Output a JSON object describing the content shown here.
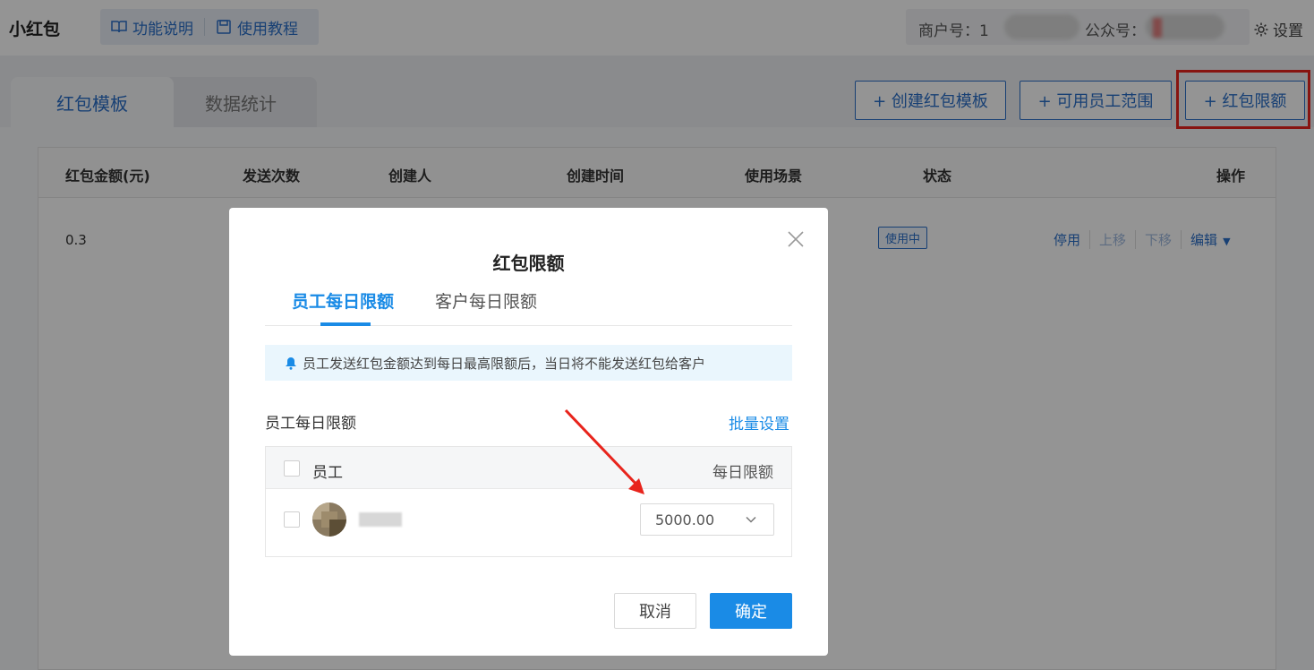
{
  "app": {
    "title": "小红包"
  },
  "top_links": [
    {
      "label": "功能说明",
      "icon": "book-icon"
    },
    {
      "label": "使用教程",
      "icon": "save-icon"
    }
  ],
  "merchant": {
    "merchant_label": "商户号：1",
    "account_label": "公众号："
  },
  "settings": {
    "label": "设置",
    "icon": "gear-icon"
  },
  "main_tabs": [
    {
      "label": "红包模板",
      "active": true
    },
    {
      "label": "数据统计",
      "active": false
    }
  ],
  "toolbar": {
    "create_template": "+ 创建红包模板",
    "staff_range": "+ 可用员工范围",
    "limit": "+ 红包限额"
  },
  "table": {
    "headers": [
      "红包金额(元)",
      "发送次数",
      "创建人",
      "创建时间",
      "使用场景",
      "状态",
      "操作"
    ],
    "rows": [
      {
        "amount": "0.3",
        "status": "使用中",
        "ops": [
          "停用",
          "上移",
          "下移",
          "编辑"
        ]
      }
    ]
  },
  "modal": {
    "title": "红包限额",
    "tabs": [
      "员工每日限额",
      "客户每日限额"
    ],
    "notice": "员工发送红包金额达到每日最高限额后，当日将不能发送红包给客户",
    "section_label": "员工每日限额",
    "batch_link": "批量设置",
    "inner_headers": {
      "employee": "员工",
      "limit": "每日限额"
    },
    "rows": [
      {
        "limit_value": "5000.00"
      }
    ],
    "cancel": "取消",
    "confirm": "确定"
  },
  "colors": {
    "accent": "#1a8be6",
    "primary_blue": "#2a6fc9",
    "highlight_red": "#e8241c"
  }
}
